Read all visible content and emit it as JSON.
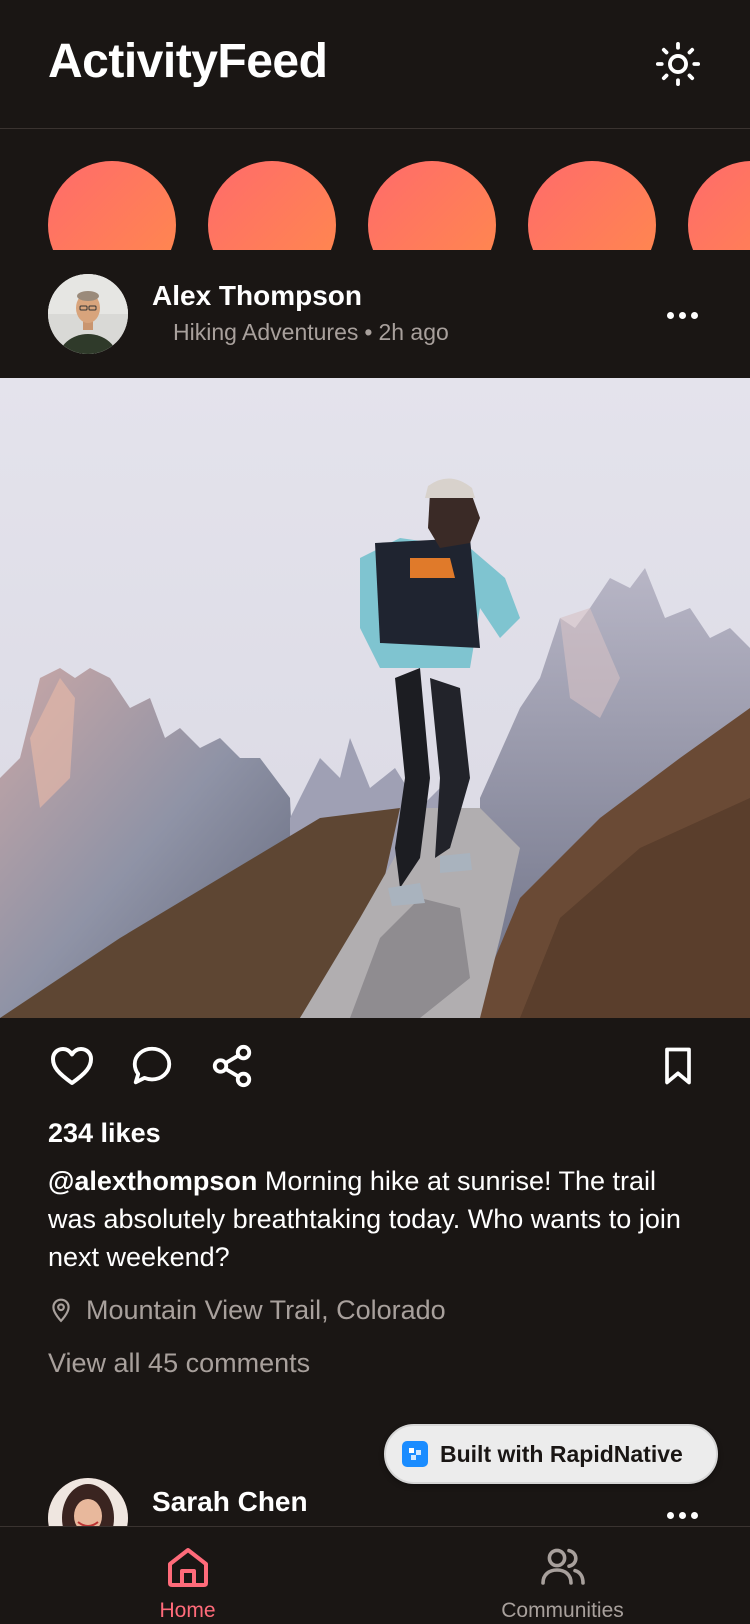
{
  "app": {
    "title": "ActivityFeed"
  },
  "header": {
    "theme_toggle_icon": "sun-icon"
  },
  "stories": {
    "count": 5,
    "gradient": [
      "#ff6b6b",
      "#ff8a4c"
    ]
  },
  "post": {
    "author": "Alex Thompson",
    "community": "Hiking Adventures",
    "separator": "•",
    "time": "2h ago",
    "likes": "234 likes",
    "handle": "@alexthompson",
    "caption": " Morning hike at sunrise! The trail was absolutely breathtaking today. Who wants to join next weekend?",
    "location": "Mountain View Trail, Colorado",
    "view_comments": "View all 45 comments"
  },
  "next_post": {
    "author": "Sarah Chen"
  },
  "badge": {
    "label": "Built with RapidNative"
  },
  "tabs": [
    {
      "label": "Home",
      "icon": "home-icon",
      "active": true
    },
    {
      "label": "Communities",
      "icon": "users-icon",
      "active": false
    }
  ],
  "colors": {
    "background": "#1a1614",
    "accent": "#ff6b7a",
    "muted": "#a8a09c"
  }
}
